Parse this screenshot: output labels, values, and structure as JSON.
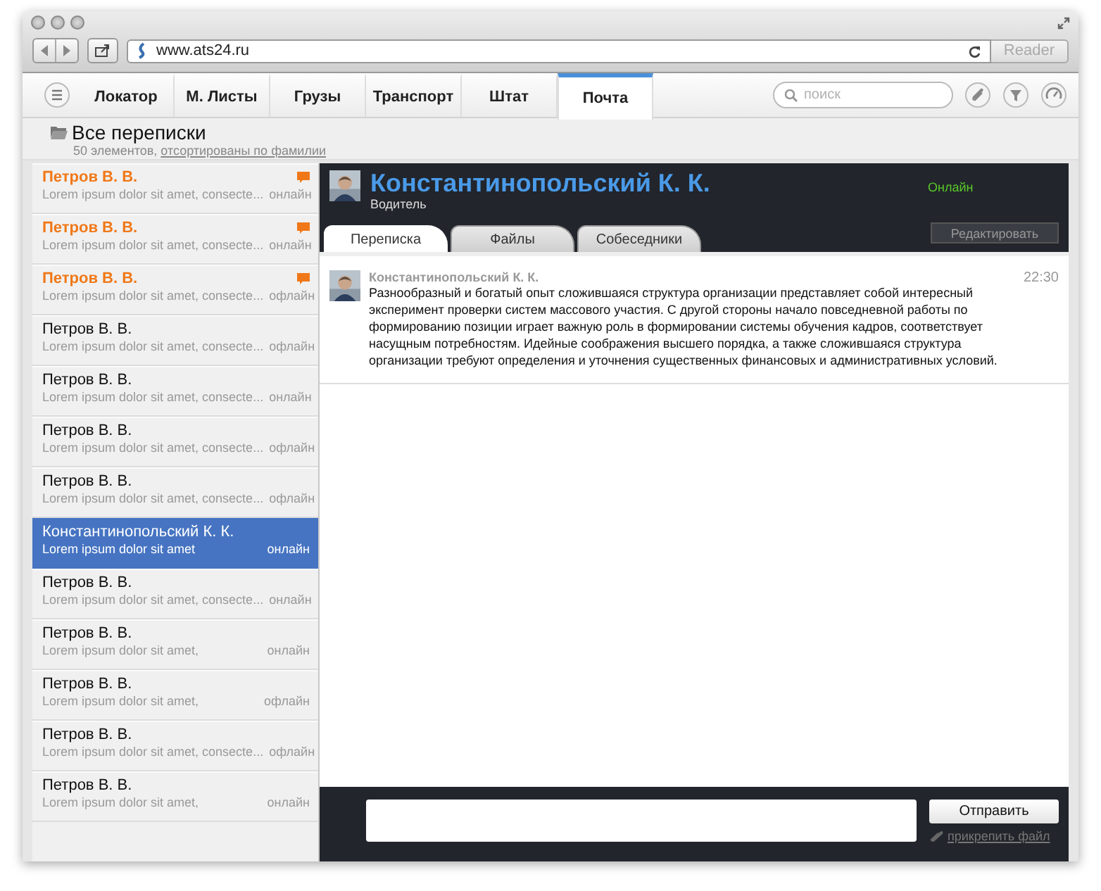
{
  "browser": {
    "url": "www.ats24.ru",
    "reader_button": "Reader"
  },
  "nav": {
    "tabs": [
      {
        "label": "Локатор",
        "selected": false
      },
      {
        "label": "М. Листы",
        "selected": false
      },
      {
        "label": "Грузы",
        "selected": false
      },
      {
        "label": "Транспорт",
        "selected": false
      },
      {
        "label": "Штат",
        "selected": false
      },
      {
        "label": "Почта",
        "selected": true
      }
    ],
    "search": {
      "placeholder": "поиск"
    }
  },
  "folder": {
    "title": "Все переписки",
    "count": "50 элементов,",
    "sort_link": "отсортированы по фамилии"
  },
  "contacts": [
    {
      "name": "Петров В. В.",
      "preview": "Lorem ipsum dolor sit amet, consecte...",
      "status": "онлайн",
      "unread": true,
      "selected": false
    },
    {
      "name": "Петров В. В.",
      "preview": "Lorem ipsum dolor sit amet, consecte...",
      "status": "онлайн",
      "unread": true,
      "selected": false
    },
    {
      "name": "Петров В. В.",
      "preview": "Lorem ipsum dolor sit amet, consecte...",
      "status": "офлайн",
      "unread": true,
      "selected": false
    },
    {
      "name": "Петров В. В.",
      "preview": "Lorem ipsum dolor sit amet, consecte...",
      "status": "офлайн",
      "unread": false,
      "selected": false
    },
    {
      "name": "Петров В. В.",
      "preview": "Lorem ipsum dolor sit amet, consecte...",
      "status": "онлайн",
      "unread": false,
      "selected": false
    },
    {
      "name": "Петров В. В.",
      "preview": "Lorem ipsum dolor sit amet, consecte...",
      "status": "офлайн",
      "unread": false,
      "selected": false
    },
    {
      "name": "Петров В. В.",
      "preview": "Lorem ipsum dolor sit amet, consecte...",
      "status": "офлайн",
      "unread": false,
      "selected": false
    },
    {
      "name": "Константинопольский К. К.",
      "preview": "Lorem ipsum dolor sit amet",
      "status": "онлайн",
      "unread": false,
      "selected": true
    },
    {
      "name": "Петров В. В.",
      "preview": "Lorem ipsum dolor sit amet, consecte...",
      "status": "онлайн",
      "unread": false,
      "selected": false
    },
    {
      "name": "Петров В. В.",
      "preview": "Lorem ipsum dolor sit amet,",
      "status": "онлайн",
      "unread": false,
      "selected": false
    },
    {
      "name": "Петров В. В.",
      "preview": "Lorem ipsum dolor sit amet,",
      "status": "офлайн",
      "unread": false,
      "selected": false
    },
    {
      "name": "Петров В. В.",
      "preview": "Lorem ipsum dolor sit amet, consecte...",
      "status": "офлайн",
      "unread": false,
      "selected": false
    },
    {
      "name": "Петров В. В.",
      "preview": "Lorem ipsum dolor sit amet,",
      "status": "онлайн",
      "unread": false,
      "selected": false
    }
  ],
  "chat": {
    "name": "Константинопольский К. К.",
    "role": "Водитель",
    "status": "Онлайн",
    "edit_button": "Редактировать",
    "tabs": [
      {
        "label": "Переписка",
        "selected": true
      },
      {
        "label": "Файлы",
        "selected": false
      },
      {
        "label": "Собеседники",
        "selected": false
      }
    ],
    "messages": [
      {
        "author": "Константинопольский К. К.",
        "time": "22:30",
        "text": "Разнообразный и богатый опыт сложившаяся структура организации представляет собой интересный эксперимент проверки систем массового участия. С другой стороны начало повседневной работы по формированию позиции играет важную роль в формировании системы обучения кадров, соответствует насущным потребностям. Идейные соображения высшего порядка, а также сложившаяся структура организации требуют определения и уточнения существенных финансовых и административных условий."
      }
    ],
    "compose": {
      "send_button": "Отправить",
      "attach_link": "прикрепить файл"
    }
  }
}
